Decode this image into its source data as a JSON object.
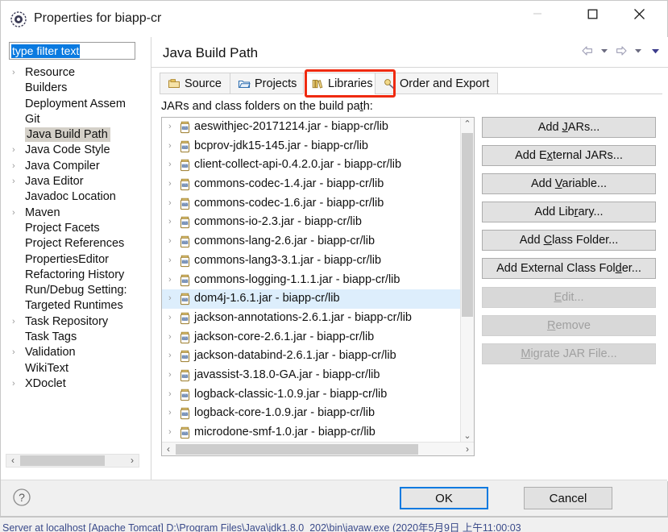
{
  "window": {
    "title": "Properties for biapp-cr",
    "icon": "eclipse-properties-icon",
    "minimize_label": "—",
    "maximize_label": "□",
    "close_label": "✕"
  },
  "filter": {
    "value": "type filter text",
    "placeholder": "type filter text"
  },
  "tree": {
    "items": [
      {
        "label": "Resource",
        "expandable": true,
        "selected": false
      },
      {
        "label": "Builders",
        "expandable": false,
        "selected": false
      },
      {
        "label": "Deployment Assem",
        "expandable": false,
        "selected": false
      },
      {
        "label": "Git",
        "expandable": false,
        "selected": false
      },
      {
        "label": "Java Build Path",
        "expandable": false,
        "selected": true
      },
      {
        "label": "Java Code Style",
        "expandable": true,
        "selected": false
      },
      {
        "label": "Java Compiler",
        "expandable": true,
        "selected": false
      },
      {
        "label": "Java Editor",
        "expandable": true,
        "selected": false
      },
      {
        "label": "Javadoc Location",
        "expandable": false,
        "selected": false
      },
      {
        "label": "Maven",
        "expandable": true,
        "selected": false
      },
      {
        "label": "Project Facets",
        "expandable": false,
        "selected": false
      },
      {
        "label": "Project References",
        "expandable": false,
        "selected": false
      },
      {
        "label": "PropertiesEditor",
        "expandable": false,
        "selected": false
      },
      {
        "label": "Refactoring History",
        "expandable": false,
        "selected": false
      },
      {
        "label": "Run/Debug Setting:",
        "expandable": false,
        "selected": false
      },
      {
        "label": "Targeted Runtimes",
        "expandable": false,
        "selected": false
      },
      {
        "label": "Task Repository",
        "expandable": true,
        "selected": false
      },
      {
        "label": "Task Tags",
        "expandable": false,
        "selected": false
      },
      {
        "label": "Validation",
        "expandable": true,
        "selected": false
      },
      {
        "label": "WikiText",
        "expandable": false,
        "selected": false
      },
      {
        "label": "XDoclet",
        "expandable": true,
        "selected": false
      }
    ],
    "twisty_glyph": "›",
    "hscroll_left": "‹",
    "hscroll_right": "›"
  },
  "page": {
    "title": "Java Build Path",
    "nav": {
      "back_icon": "back-arrow-icon",
      "back_menu_icon": "chevron-down-icon",
      "forward_icon": "forward-arrow-icon",
      "forward_menu_icon": "chevron-down-icon",
      "extra_menu_icon": "chevron-down-icon"
    }
  },
  "tabs": [
    {
      "label": "Source",
      "icon": "source-folder-icon",
      "active": false
    },
    {
      "label": "Projects",
      "icon": "projects-folder-icon",
      "active": false
    },
    {
      "label": "Libraries",
      "icon": "libraries-icon",
      "active": true
    },
    {
      "label": "Order and Export",
      "icon": "order-export-icon",
      "active": false
    }
  ],
  "libraries": {
    "section_label_before": "JARs and class folders on the build pa",
    "section_label_mnemonic": "t",
    "section_label_after": "h:",
    "entries": [
      {
        "name": "aeswithjec-20171214.jar - biapp-cr/lib",
        "selected": false
      },
      {
        "name": "bcprov-jdk15-145.jar - biapp-cr/lib",
        "selected": false
      },
      {
        "name": "client-collect-api-0.4.2.0.jar - biapp-cr/lib",
        "selected": false
      },
      {
        "name": "commons-codec-1.4.jar - biapp-cr/lib",
        "selected": false
      },
      {
        "name": "commons-codec-1.6.jar - biapp-cr/lib",
        "selected": false
      },
      {
        "name": "commons-io-2.3.jar - biapp-cr/lib",
        "selected": false
      },
      {
        "name": "commons-lang-2.6.jar - biapp-cr/lib",
        "selected": false
      },
      {
        "name": "commons-lang3-3.1.jar - biapp-cr/lib",
        "selected": false
      },
      {
        "name": "commons-logging-1.1.1.jar - biapp-cr/lib",
        "selected": false
      },
      {
        "name": "dom4j-1.6.1.jar - biapp-cr/lib",
        "selected": true
      },
      {
        "name": "jackson-annotations-2.6.1.jar - biapp-cr/lib",
        "selected": false
      },
      {
        "name": "jackson-core-2.6.1.jar - biapp-cr/lib",
        "selected": false
      },
      {
        "name": "jackson-databind-2.6.1.jar - biapp-cr/lib",
        "selected": false
      },
      {
        "name": "javassist-3.18.0-GA.jar - biapp-cr/lib",
        "selected": false
      },
      {
        "name": "logback-classic-1.0.9.jar - biapp-cr/lib",
        "selected": false
      },
      {
        "name": "logback-core-1.0.9.jar - biapp-cr/lib",
        "selected": false
      },
      {
        "name": "microdone-smf-1.0.jar - biapp-cr/lib",
        "selected": false
      }
    ],
    "twisty_glyph": "›",
    "scroll_up": "⌃",
    "scroll_down": "⌄",
    "hscroll_left": "‹",
    "hscroll_right": "›"
  },
  "side_buttons": [
    {
      "before": "Add ",
      "mnemonic": "J",
      "after": "ARs...",
      "disabled": false,
      "name": "add-jars-button"
    },
    {
      "before": "Add E",
      "mnemonic": "x",
      "after": "ternal JARs...",
      "disabled": false,
      "name": "add-external-jars-button"
    },
    {
      "before": "Add ",
      "mnemonic": "V",
      "after": "ariable...",
      "disabled": false,
      "name": "add-variable-button"
    },
    {
      "before": "Add Lib",
      "mnemonic": "r",
      "after": "ary...",
      "disabled": false,
      "name": "add-library-button"
    },
    {
      "before": "Add ",
      "mnemonic": "C",
      "after": "lass Folder...",
      "disabled": false,
      "name": "add-class-folder-button"
    },
    {
      "before": "Add External Class Fol",
      "mnemonic": "d",
      "after": "er...",
      "disabled": false,
      "name": "add-external-class-folder-button"
    },
    {
      "before": "",
      "mnemonic": "E",
      "after": "dit...",
      "disabled": true,
      "name": "edit-button"
    },
    {
      "before": "",
      "mnemonic": "R",
      "after": "emove",
      "disabled": true,
      "name": "remove-button"
    },
    {
      "before": "",
      "mnemonic": "M",
      "after": "igrate JAR File...",
      "disabled": true,
      "name": "migrate-jar-file-button"
    }
  ],
  "footer": {
    "help_icon": "help-question-icon",
    "ok_label": "OK",
    "cancel_label": "Cancel"
  },
  "statusbar": {
    "text": "Server at localhost [Apache Tomcat] D:\\Program Files\\Java\\jdk1.8.0_202\\bin\\javaw.exe (2020年5月9日 上午11:00:03"
  },
  "colors": {
    "selection_blue": "#0a7ae0",
    "row_selection": "#ddeefc",
    "tree_selection": "#d4d0c8",
    "annotation_red": "#ef2a10"
  }
}
